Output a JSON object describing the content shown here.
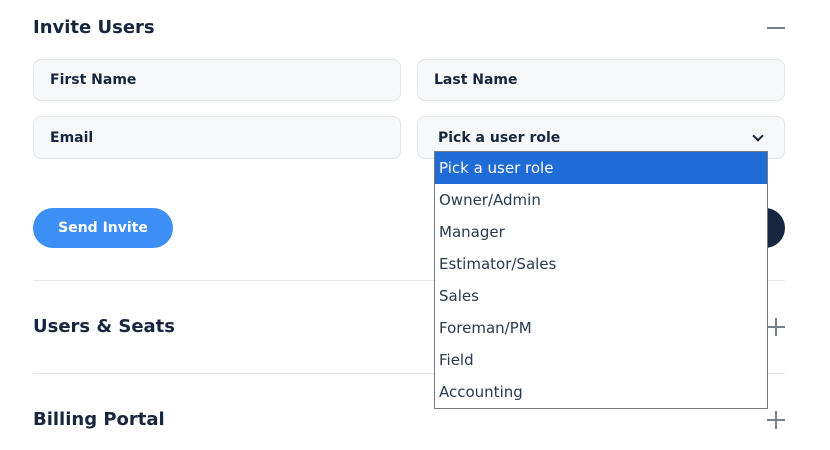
{
  "invite_users": {
    "title": "Invite Users",
    "first_name_placeholder": "First Name",
    "last_name_placeholder": "Last Name",
    "email_placeholder": "Email",
    "role_select": {
      "selected": "Pick a user role",
      "options": [
        "Pick a user role",
        "Owner/Admin",
        "Manager",
        "Estimator/Sales",
        "Sales",
        "Foreman/PM",
        "Field",
        "Accounting"
      ]
    },
    "send_invite_label": "Send Invite"
  },
  "users_seats": {
    "title": "Users & Seats"
  },
  "billing_portal": {
    "title": "Billing Portal"
  },
  "colors": {
    "primary": "#3e8ff5",
    "dark": "#16263f",
    "highlight": "#1f6cd6"
  }
}
